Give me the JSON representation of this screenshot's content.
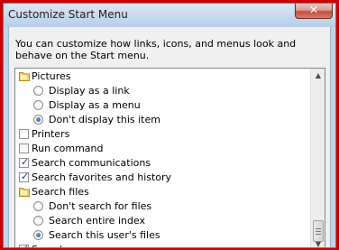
{
  "window": {
    "title": "Customize Start Menu",
    "close_glyph": "✕"
  },
  "description": "You can customize how links, icons, and menus look and behave on the Start menu.",
  "items": [
    {
      "type": "folder",
      "label": "Pictures"
    },
    {
      "type": "radio",
      "label": "Display as a link",
      "checked": false
    },
    {
      "type": "radio",
      "label": "Display as a menu",
      "checked": false
    },
    {
      "type": "radio",
      "label": "Don't display this item",
      "checked": true
    },
    {
      "type": "checkbox",
      "label": "Printers",
      "checked": false
    },
    {
      "type": "checkbox",
      "label": "Run command",
      "checked": false
    },
    {
      "type": "checkbox",
      "label": "Search communications",
      "checked": true
    },
    {
      "type": "checkbox",
      "label": "Search favorites and history",
      "checked": true
    },
    {
      "type": "folder",
      "label": "Search files"
    },
    {
      "type": "radio",
      "label": "Don't search for files",
      "checked": false
    },
    {
      "type": "radio",
      "label": "Search entire index",
      "checked": false
    },
    {
      "type": "radio",
      "label": "Search this user's files",
      "checked": true
    },
    {
      "type": "checkbox",
      "label": "Search programs",
      "checked": true
    }
  ],
  "scrollbar": {
    "up_glyph": "▲",
    "down_glyph": "▼"
  }
}
